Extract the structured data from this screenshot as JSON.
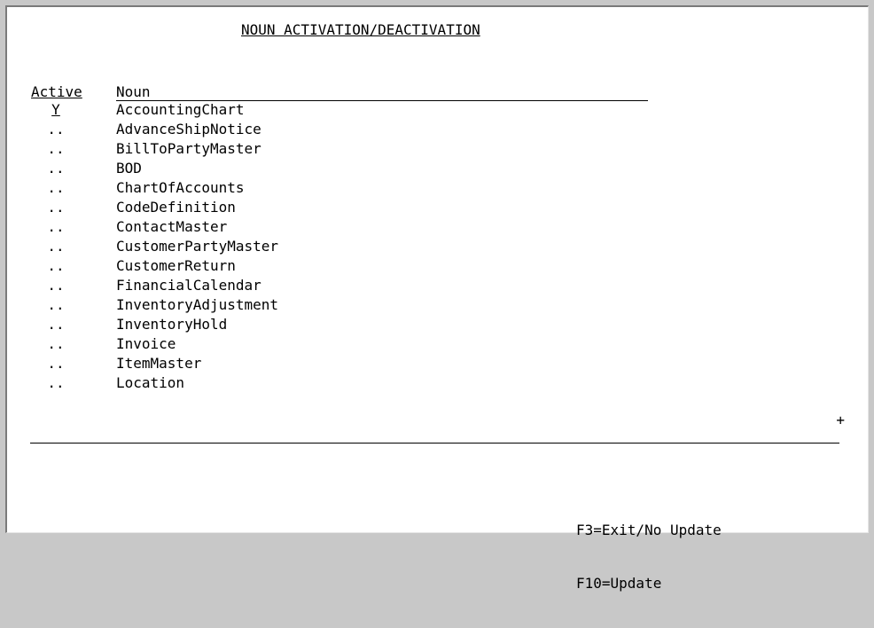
{
  "screen": {
    "title": "NOUN ACTIVATION/DEACTIVATION",
    "columns": {
      "active": "Active",
      "noun": "Noun"
    },
    "rows": [
      {
        "active": "Y",
        "noun": "AccountingChart"
      },
      {
        "active": "..",
        "noun": "AdvanceShipNotice"
      },
      {
        "active": "..",
        "noun": "BillToPartyMaster"
      },
      {
        "active": "..",
        "noun": "BOD"
      },
      {
        "active": "..",
        "noun": "ChartOfAccounts"
      },
      {
        "active": "..",
        "noun": "CodeDefinition"
      },
      {
        "active": "..",
        "noun": "ContactMaster"
      },
      {
        "active": "..",
        "noun": "CustomerPartyMaster"
      },
      {
        "active": "..",
        "noun": "CustomerReturn"
      },
      {
        "active": "..",
        "noun": "FinancialCalendar"
      },
      {
        "active": "..",
        "noun": "InventoryAdjustment"
      },
      {
        "active": "..",
        "noun": "InventoryHold"
      },
      {
        "active": "..",
        "noun": "Invoice"
      },
      {
        "active": "..",
        "noun": "ItemMaster"
      },
      {
        "active": "..",
        "noun": "Location"
      }
    ],
    "more_indicator": "+",
    "function_keys": [
      "F3=Exit/No Update",
      "F10=Update"
    ]
  }
}
